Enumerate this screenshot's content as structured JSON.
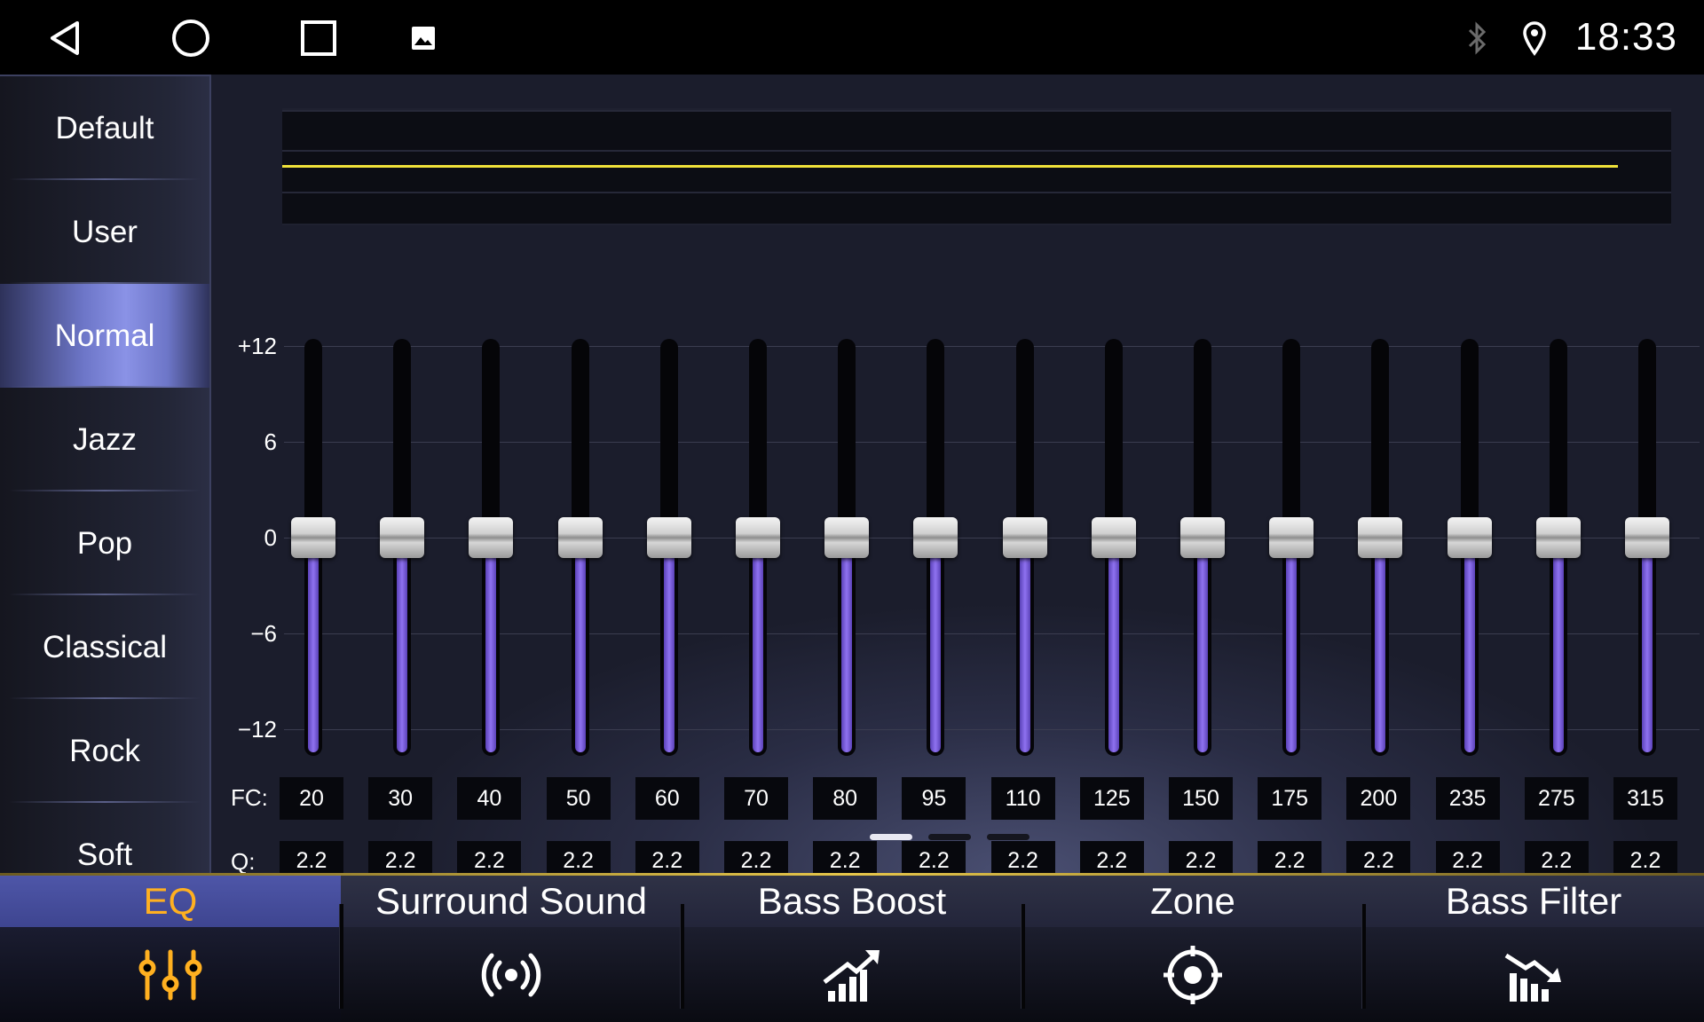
{
  "status_bar": {
    "time": "18:33",
    "nav_icons": [
      "back-icon",
      "home-icon",
      "recents-icon",
      "gallery-icon"
    ],
    "status_icons": [
      "bluetooth-icon",
      "location-icon"
    ]
  },
  "presets": [
    "Default",
    "User",
    "Normal",
    "Jazz",
    "Pop",
    "Classical",
    "Rock",
    "Soft"
  ],
  "active_preset": "Normal",
  "eq": {
    "y_ticks": [
      "+12",
      "6",
      "0",
      "−6",
      "−12"
    ],
    "y_range": [
      -12,
      12
    ],
    "fc_label": "FC:",
    "q_label": "Q:",
    "bands": [
      {
        "fc": "20",
        "q": "2.2",
        "gain": 0
      },
      {
        "fc": "30",
        "q": "2.2",
        "gain": 0
      },
      {
        "fc": "40",
        "q": "2.2",
        "gain": 0
      },
      {
        "fc": "50",
        "q": "2.2",
        "gain": 0
      },
      {
        "fc": "60",
        "q": "2.2",
        "gain": 0
      },
      {
        "fc": "70",
        "q": "2.2",
        "gain": 0
      },
      {
        "fc": "80",
        "q": "2.2",
        "gain": 0
      },
      {
        "fc": "95",
        "q": "2.2",
        "gain": 0
      },
      {
        "fc": "110",
        "q": "2.2",
        "gain": 0
      },
      {
        "fc": "125",
        "q": "2.2",
        "gain": 0
      },
      {
        "fc": "150",
        "q": "2.2",
        "gain": 0
      },
      {
        "fc": "175",
        "q": "2.2",
        "gain": 0
      },
      {
        "fc": "200",
        "q": "2.2",
        "gain": 0
      },
      {
        "fc": "235",
        "q": "2.2",
        "gain": 0
      },
      {
        "fc": "275",
        "q": "2.2",
        "gain": 0
      },
      {
        "fc": "315",
        "q": "2.2",
        "gain": 0
      }
    ],
    "curve_color": "#f0e23a",
    "fill_color": "#7b5fe0"
  },
  "pager": {
    "pages": 3,
    "current": 1
  },
  "tabs": [
    {
      "label": "EQ",
      "icon": "equalizer-icon"
    },
    {
      "label": "Surround Sound",
      "icon": "surround-icon"
    },
    {
      "label": "Bass Boost",
      "icon": "bass-boost-icon"
    },
    {
      "label": "Zone",
      "icon": "zone-target-icon"
    },
    {
      "label": "Bass Filter",
      "icon": "bass-filter-icon"
    }
  ],
  "active_tab": "EQ",
  "accent_color": "#ffb020"
}
